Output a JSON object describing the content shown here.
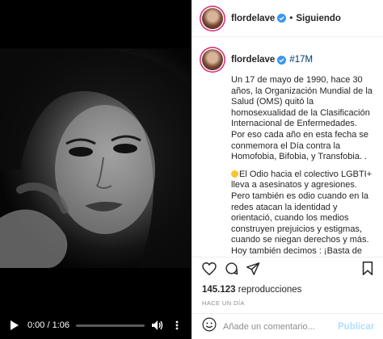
{
  "post": {
    "username": "flordelave",
    "separator": "•",
    "follow_status": "Siguiendo",
    "hashtag": "#17M",
    "caption_paragraphs": [
      "Un 17 de mayo de 1990, hace 30 años, la Organización Mundial de la Salud (OMS) quitó la homosexualidad de la Clasificación Internacional de Enfermedades. Por eso cada año en esta fecha se conmemora el Día contra la Homofobia, Bifobia, y Transfobia. .",
      "El Odio hacia el colectivo LGBTI+ lleva a asesinatos y agresiones. Pero también es odio cuando en la redes atacan la identidad y orientació, cuando los medios construyen prejuicios y estigmas, cuando se niegan derechos y más. Hoy también decimos : ¡Basta de LGBTIodio! ."
    ],
    "views_count": "145.123",
    "views_label": "reproducciones",
    "time_ago": "Hace un día"
  },
  "video": {
    "current_time": "0:00",
    "duration": "1:06",
    "time_display": "0:00 / 1:06",
    "progress": 0.0
  },
  "comment": {
    "placeholder": "Añade un comentario...",
    "publish_label": "Publicar"
  },
  "colors": {
    "story_ring": "#d62976",
    "verified": "#3897f0",
    "link": "#00376b",
    "publish_disabled": "#b2dffc",
    "muted": "#8e8e8e"
  },
  "icons": {
    "play": "play-icon",
    "volume": "volume-icon",
    "more": "more-vertical-icon",
    "like": "heart-icon",
    "comment": "comment-icon",
    "share": "paper-plane-icon",
    "save": "bookmark-icon",
    "emoji": "emoji-icon",
    "verified": "verified-badge-icon",
    "sun": "sun-emoji-icon"
  }
}
